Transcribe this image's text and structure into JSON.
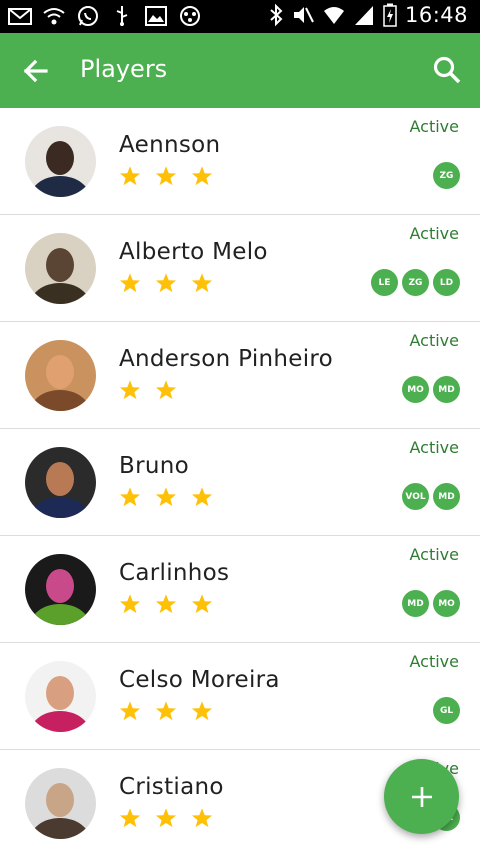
{
  "status_bar": {
    "time": "16:48",
    "left_icons": [
      "mail-icon",
      "wifi-icon",
      "whatsapp-icon",
      "usb-icon",
      "image-icon",
      "app-icon"
    ],
    "right_icons": [
      "bluetooth-icon",
      "mute-icon",
      "wifi-icon",
      "signal-icon",
      "battery-icon"
    ]
  },
  "app_bar": {
    "title": "Players",
    "back_icon": "arrow-back-icon",
    "search_icon": "search-icon"
  },
  "colors": {
    "primary": "#4caf50",
    "status_text": "#2e7d32",
    "star": "#ffc107"
  },
  "players": [
    {
      "name": "Aennson",
      "status": "Active",
      "stars": 3,
      "positions": [
        "ZG"
      ],
      "avatar": "avatar-photo"
    },
    {
      "name": "Alberto Melo",
      "status": "Active",
      "stars": 3,
      "positions": [
        "LE",
        "ZG",
        "LD"
      ],
      "avatar": "avatar-photo"
    },
    {
      "name": "Anderson Pinheiro",
      "status": "Active",
      "stars": 2,
      "positions": [
        "MO",
        "MD"
      ],
      "avatar": "avatar-photo"
    },
    {
      "name": "Bruno",
      "status": "Active",
      "stars": 3,
      "positions": [
        "VOL",
        "MD"
      ],
      "avatar": "avatar-photo"
    },
    {
      "name": "Carlinhos",
      "status": "Active",
      "stars": 3,
      "positions": [
        "MD",
        "MO"
      ],
      "avatar": "avatar-photo"
    },
    {
      "name": "Celso Moreira",
      "status": "Active",
      "stars": 3,
      "positions": [
        "GL"
      ],
      "avatar": "avatar-photo"
    },
    {
      "name": "Cristiano",
      "status": "Active",
      "stars": 3,
      "positions": [
        "GL"
      ],
      "avatar": "avatar-photo"
    }
  ],
  "fab": {
    "icon": "add-icon"
  }
}
